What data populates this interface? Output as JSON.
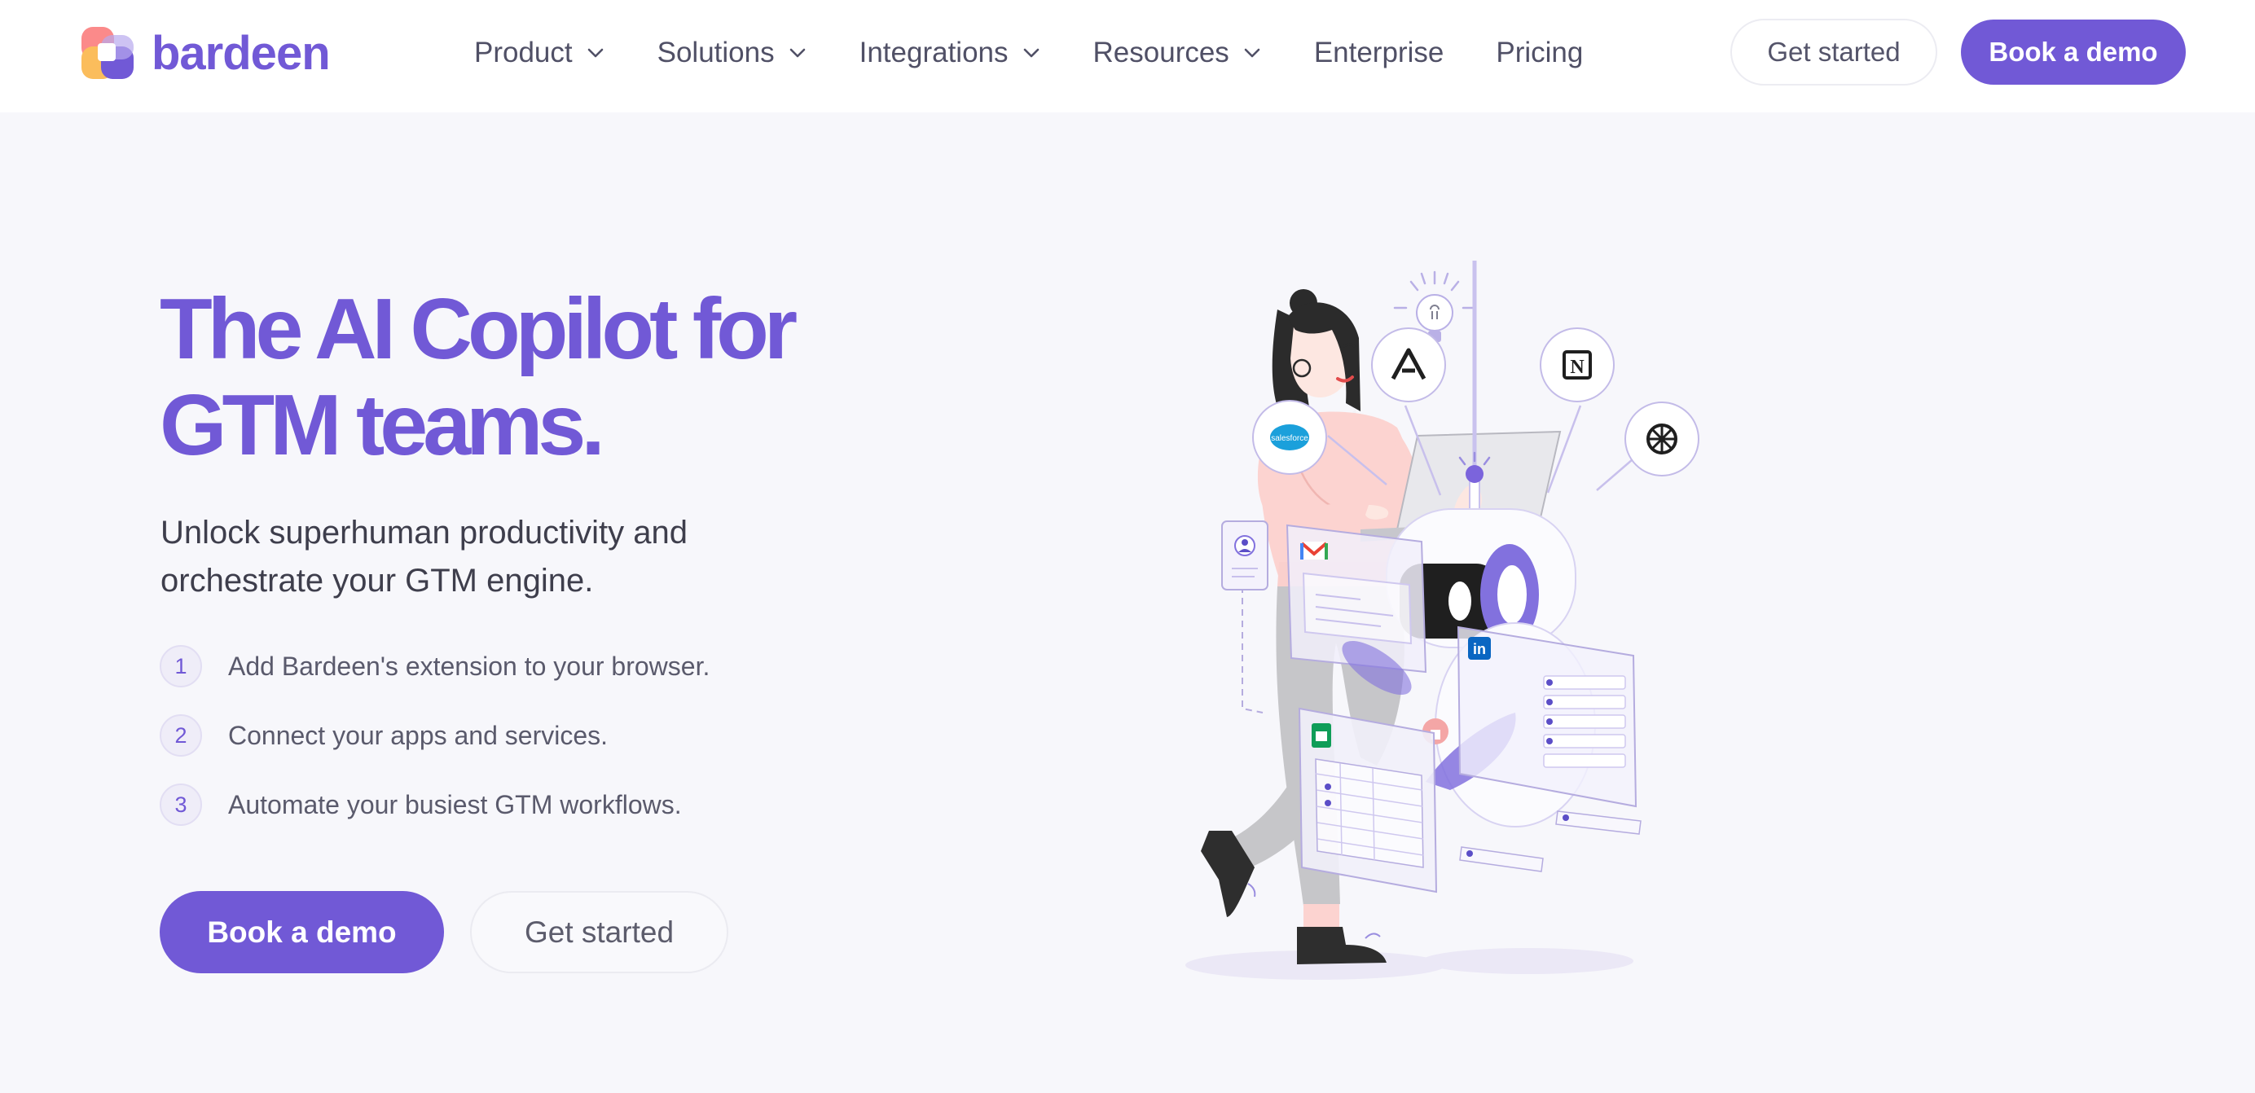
{
  "brand": {
    "name": "bardeen",
    "accent": "#7159d6"
  },
  "nav": {
    "items": [
      {
        "label": "Product",
        "dropdown": true
      },
      {
        "label": "Solutions",
        "dropdown": true
      },
      {
        "label": "Integrations",
        "dropdown": true
      },
      {
        "label": "Resources",
        "dropdown": true
      },
      {
        "label": "Enterprise",
        "dropdown": false
      },
      {
        "label": "Pricing",
        "dropdown": false
      }
    ],
    "get_started": "Get started",
    "book_demo": "Book a demo"
  },
  "hero": {
    "title_line1": "The AI Copilot for",
    "title_line2": "GTM teams.",
    "subtitle_line1": "Unlock superhuman productivity and",
    "subtitle_line2": "orchestrate your GTM engine.",
    "steps": [
      {
        "num": "1",
        "text": "Add Bardeen's extension to your browser."
      },
      {
        "num": "2",
        "text": "Connect your apps and services."
      },
      {
        "num": "3",
        "text": "Automate your busiest GTM workflows."
      }
    ],
    "cta_primary": "Book a demo",
    "cta_secondary": "Get started"
  },
  "illustration": {
    "icons": [
      "salesforce-icon",
      "apollo-icon",
      "notion-icon",
      "openai-icon",
      "gmail-icon",
      "linkedin-icon",
      "google-sheets-icon",
      "lightbulb-icon"
    ],
    "labels": {
      "salesforce": "salesforce",
      "notion": "N",
      "linkedin": "in"
    }
  }
}
